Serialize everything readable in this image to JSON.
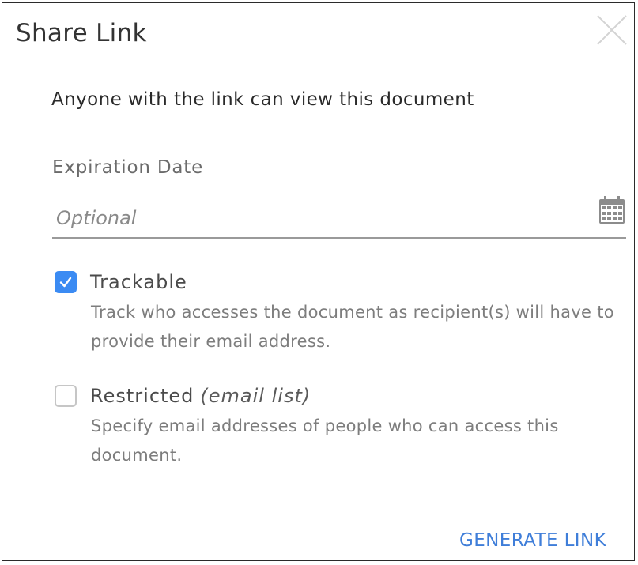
{
  "dialog": {
    "title": "Share Link",
    "subtitle": "Anyone with the link can view this document"
  },
  "expiration": {
    "label": "Expiration Date",
    "placeholder": "Optional",
    "value": ""
  },
  "options": {
    "trackable": {
      "label": "Trackable",
      "checked": true,
      "description": "Track who accesses the document as recipient(s) will have to provide their email address."
    },
    "restricted": {
      "label": "Restricted",
      "label_suffix": "(email list)",
      "checked": false,
      "description": "Specify email addresses of people who can access this document."
    }
  },
  "actions": {
    "generate_label": "GENERATE LINK"
  },
  "colors": {
    "accent": "#3b8bf3",
    "link": "#3f7ed9",
    "muted_text": "#7d7d7d"
  },
  "icons": {
    "close": "close-icon",
    "calendar": "calendar-icon",
    "checkmark": "checkmark-icon"
  }
}
